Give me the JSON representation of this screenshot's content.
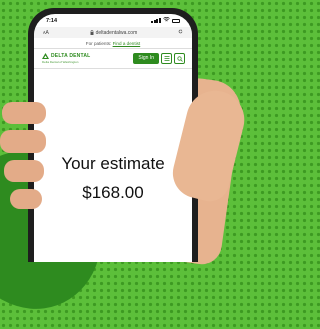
{
  "status_bar": {
    "time": "7:14"
  },
  "browser": {
    "url": "deltadentalwa.com"
  },
  "banner": {
    "prefix": "For patients:",
    "link": "Find a dentist"
  },
  "header": {
    "logo_name": "DELTA DENTAL",
    "logo_tagline": "Delta Dental of Washington",
    "signin_label": "Sign In"
  },
  "estimate": {
    "title": "Your estimate",
    "amount": "$168.00"
  },
  "colors": {
    "brand_green": "#2e8b1f",
    "background_green": "#5cbf3a"
  }
}
